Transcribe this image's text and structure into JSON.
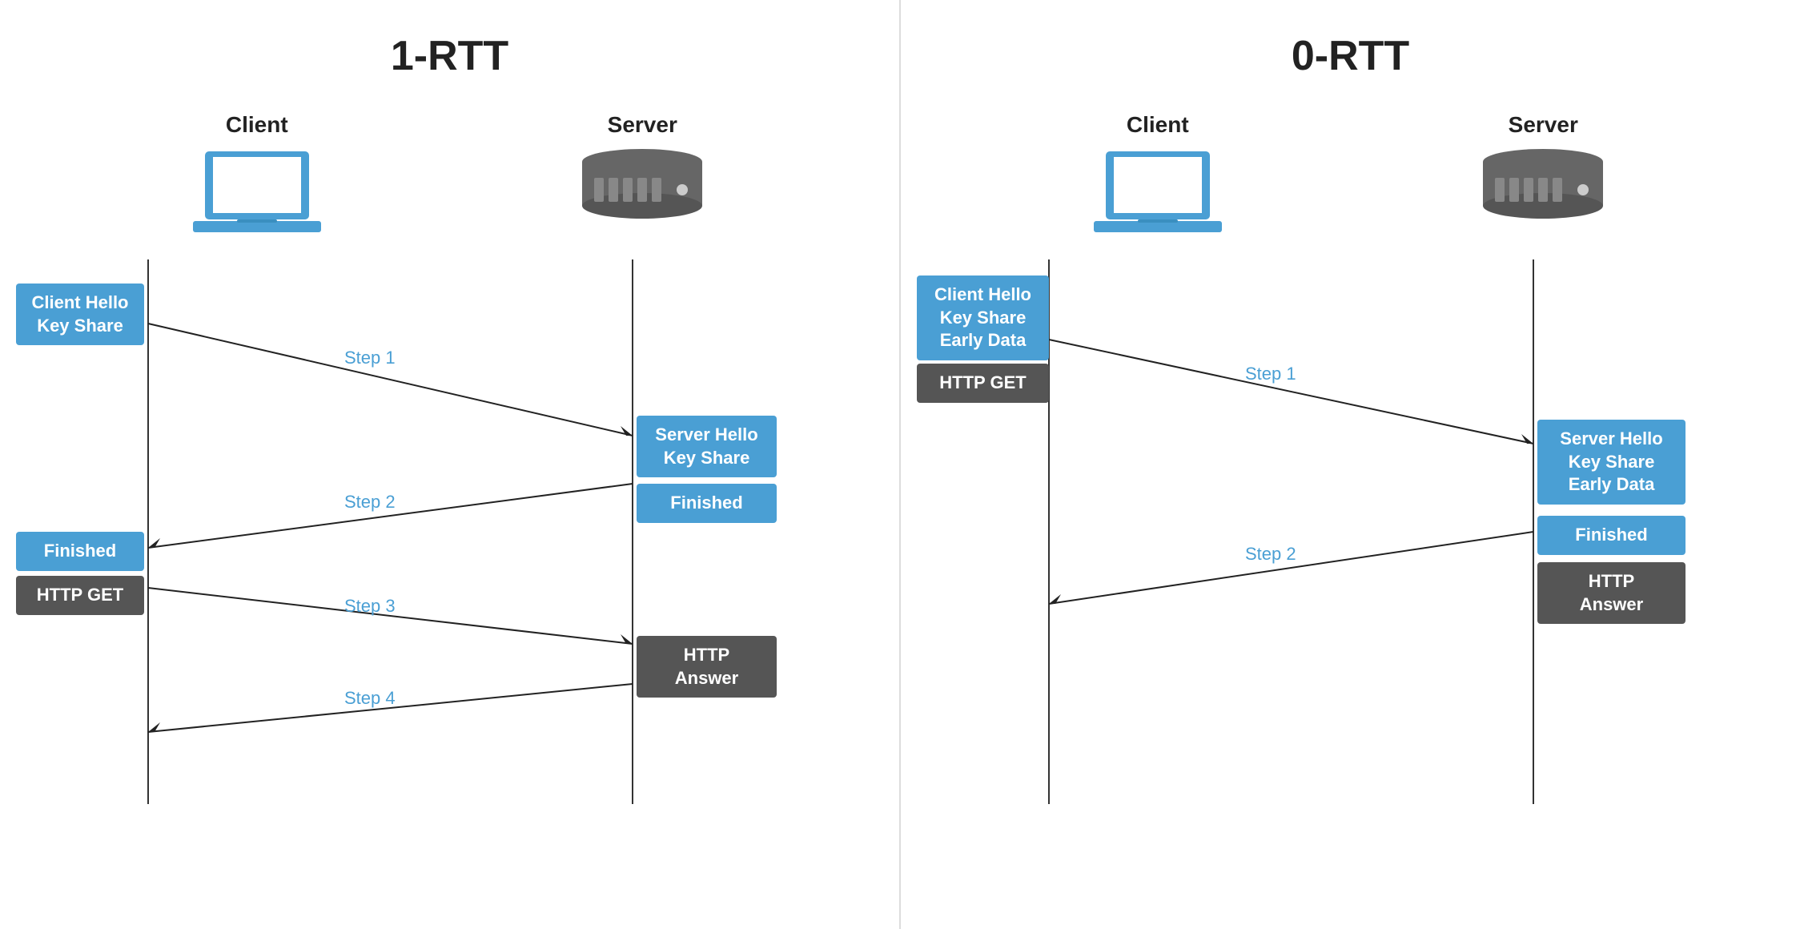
{
  "sections": [
    {
      "id": "rtt1",
      "title": "1-RTT",
      "client_label": "Client",
      "server_label": "Server",
      "messages": {
        "client_top": {
          "lines": [
            "Client Hello",
            "Key Share"
          ],
          "type": "blue"
        },
        "client_bottom_blue": {
          "lines": [
            "Finished"
          ],
          "type": "blue"
        },
        "client_bottom_dark": {
          "lines": [
            "HTTP GET"
          ],
          "type": "dark"
        },
        "server_top_blue": {
          "lines": [
            "Server Hello",
            "Key Share"
          ],
          "type": "blue"
        },
        "server_top_finished": {
          "lines": [
            "Finished"
          ],
          "type": "blue"
        },
        "server_bottom_dark": {
          "lines": [
            "HTTP",
            "Answer"
          ],
          "type": "dark"
        }
      },
      "steps": [
        "Step 1",
        "Step 2",
        "Step 3",
        "Step 4"
      ]
    },
    {
      "id": "rtt0",
      "title": "0-RTT",
      "client_label": "Client",
      "server_label": "Server",
      "messages": {
        "client_top_blue": {
          "lines": [
            "Client Hello",
            "Key Share",
            "Early Data"
          ],
          "type": "blue"
        },
        "client_top_dark": {
          "lines": [
            "HTTP GET"
          ],
          "type": "dark"
        },
        "server_top_blue": {
          "lines": [
            "Server Hello",
            "Key Share",
            "Early Data"
          ],
          "type": "blue"
        },
        "server_finished": {
          "lines": [
            "Finished"
          ],
          "type": "blue"
        },
        "server_dark": {
          "lines": [
            "HTTP",
            "Answer"
          ],
          "type": "dark"
        }
      },
      "steps": [
        "Step 1",
        "Step 2"
      ]
    }
  ],
  "colors": {
    "blue": "#4a9fd4",
    "dark": "#555555",
    "arrow": "#222222",
    "timeline": "#333333"
  }
}
